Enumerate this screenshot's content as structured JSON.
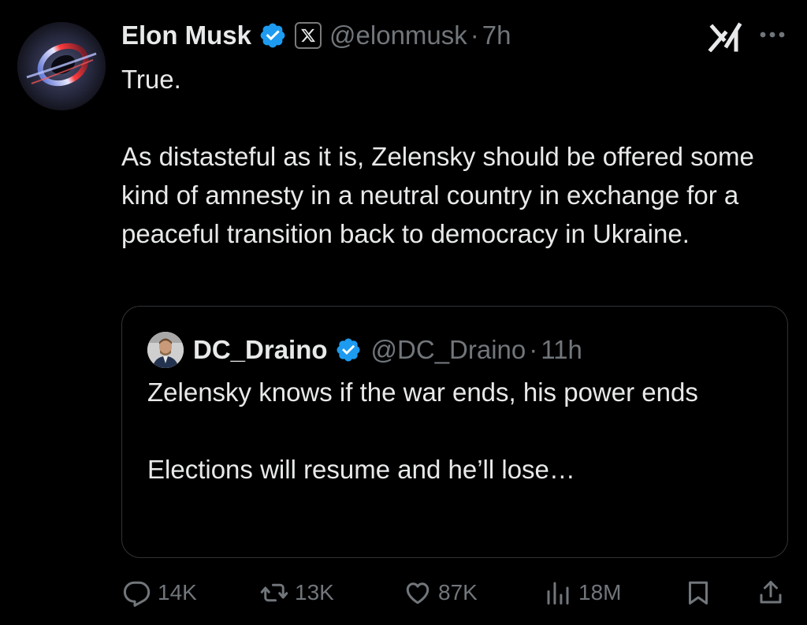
{
  "tweet": {
    "author": {
      "name": "Elon Musk",
      "handle": "@elonmusk",
      "time": "7h",
      "separator": "·"
    },
    "text": [
      "True.",
      "",
      "As distasteful as it is, Zelensky should be offered some kind of amnesty in a neutral country in exchange for a peaceful transition back to democracy in Ukraine."
    ],
    "quoted": {
      "name": "DC_Draino",
      "handle": "@DC_Draino",
      "time": "11h",
      "separator": "·",
      "text": [
        "Zelensky knows if the war ends, his power ends",
        "",
        "Elections will resume and he’ll lose…"
      ]
    },
    "stats": {
      "replies": "14K",
      "reposts": "13K",
      "likes": "87K",
      "views": "18M"
    }
  },
  "icons": {
    "verified": "verified-badge-icon",
    "affiliation": "x-logo-icon",
    "grok": "grok-icon",
    "more": "more-options-icon",
    "reply": "reply-icon",
    "repost": "repost-icon",
    "like": "like-icon",
    "views": "views-icon",
    "bookmark": "bookmark-icon",
    "share": "share-icon"
  },
  "colors": {
    "background": "#000000",
    "text": "#e7e9ea",
    "secondary": "#71767b",
    "verified": "#1d9bf0",
    "border": "#2f3336"
  }
}
